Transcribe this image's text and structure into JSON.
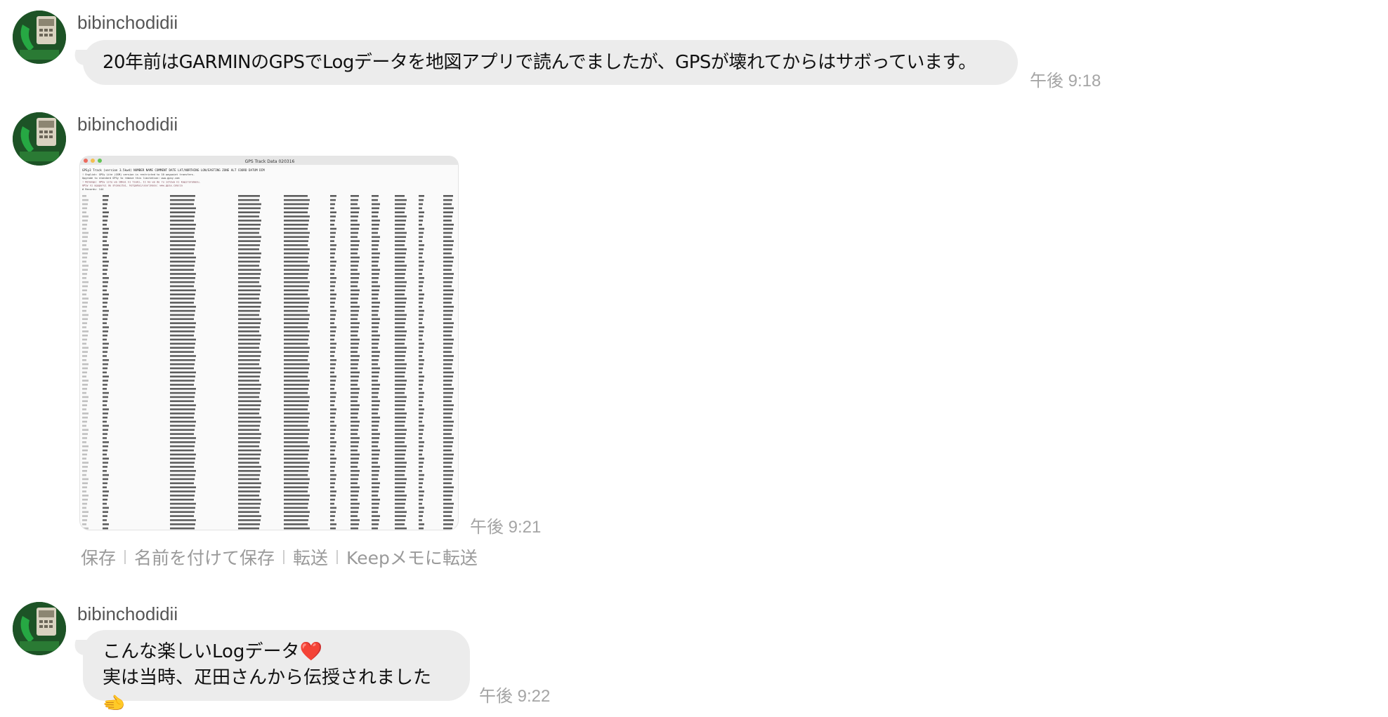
{
  "messages": [
    {
      "sender": "bibinchodidii",
      "text": "20年前はGARMINのGPSでLogデータを地図アプリで読んでましたが、GPSが壊れてからはサボっています。",
      "time": "午後 9:18"
    },
    {
      "sender": "bibinchodidii",
      "image": {
        "window_title": "GPS Track Data 020316",
        "header_line": "GPSy3 Track    (version 3.5kwd)  NUMBER   NAME    COMMENT DATE     LAT/NORTHING   LON/EASTING   ZONE   ALT    COORD   DATUM   DIM",
        "note_lines": [
          "! English: GPSy Lite (GSM) version is restricted to 10 waypoint transfers.",
          "           Upgrade to standard GPSy to remove this limitation: www.gpsy.com",
          "! Nihongo: GPSy Lite wa 10kai ni tsuki, 11 ko wo de ru ichiwa ni kagiraremasu.",
          "           GPSy ni appgurei de shimaitai. hotgahai/usurimasu: www.gpsy.com/ja",
          "#  Records: 144"
        ]
      },
      "time": "午後 9:21",
      "actions": [
        "保存",
        "名前を付けて保存",
        "転送",
        "Keepメモに転送"
      ]
    },
    {
      "sender": "bibinchodidii",
      "lines": [
        "こんな楽しいLogデータ❤️",
        "実は当時、疋田さんから伝授されました🫲"
      ],
      "time": "午後 9:22"
    }
  ]
}
